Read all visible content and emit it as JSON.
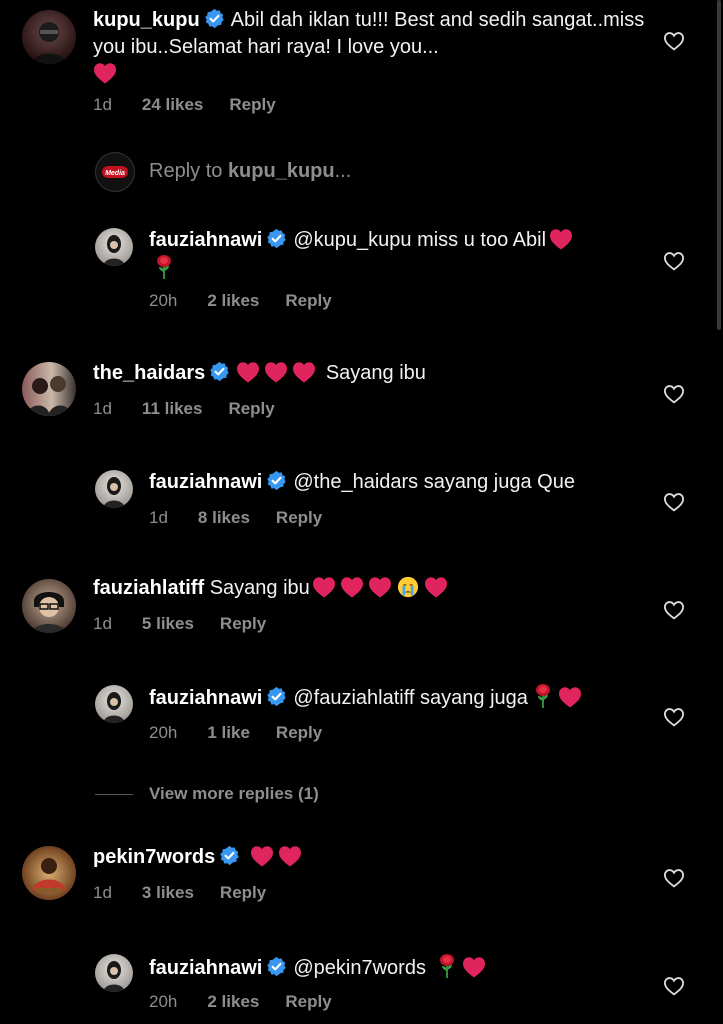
{
  "reply_input": {
    "prefix": "Reply to",
    "username": "kupu_kupu",
    "suffix": "..."
  },
  "view_more": "View more replies (1)",
  "comments": [
    {
      "username": "kupu_kupu",
      "text": "Abil dah iklan tu!!! Best and sedih sangat..miss you ibu..Selamat hari raya! I love you...",
      "time": "1d",
      "likes": "24 likes",
      "reply": "Reply"
    },
    {
      "username": "fauziahnawi",
      "text": "@kupu_kupu miss u too Abil",
      "time": "20h",
      "likes": "2 likes",
      "reply": "Reply"
    },
    {
      "username": "the_haidars",
      "text": "Sayang ibu",
      "time": "1d",
      "likes": "11 likes",
      "reply": "Reply"
    },
    {
      "username": "fauziahnawi",
      "text": "@the_haidars sayang juga Que",
      "time": "1d",
      "likes": "8 likes",
      "reply": "Reply"
    },
    {
      "username": "fauziahlatiff",
      "text": "Sayang ibu",
      "time": "1d",
      "likes": "5 likes",
      "reply": "Reply"
    },
    {
      "username": "fauziahnawi",
      "text": "@fauziahlatiff sayang juga",
      "time": "20h",
      "likes": "1 like",
      "reply": "Reply"
    },
    {
      "username": "pekin7words",
      "text": "",
      "time": "1d",
      "likes": "3 likes",
      "reply": "Reply"
    },
    {
      "username": "fauziahnawi",
      "text": "@pekin7words",
      "time": "20h",
      "likes": "2 likes",
      "reply": "Reply"
    }
  ],
  "colors": {
    "background": "#000000",
    "verified": "#3897f0",
    "heart": "#e0245e",
    "muted": "#8e8e8e"
  }
}
